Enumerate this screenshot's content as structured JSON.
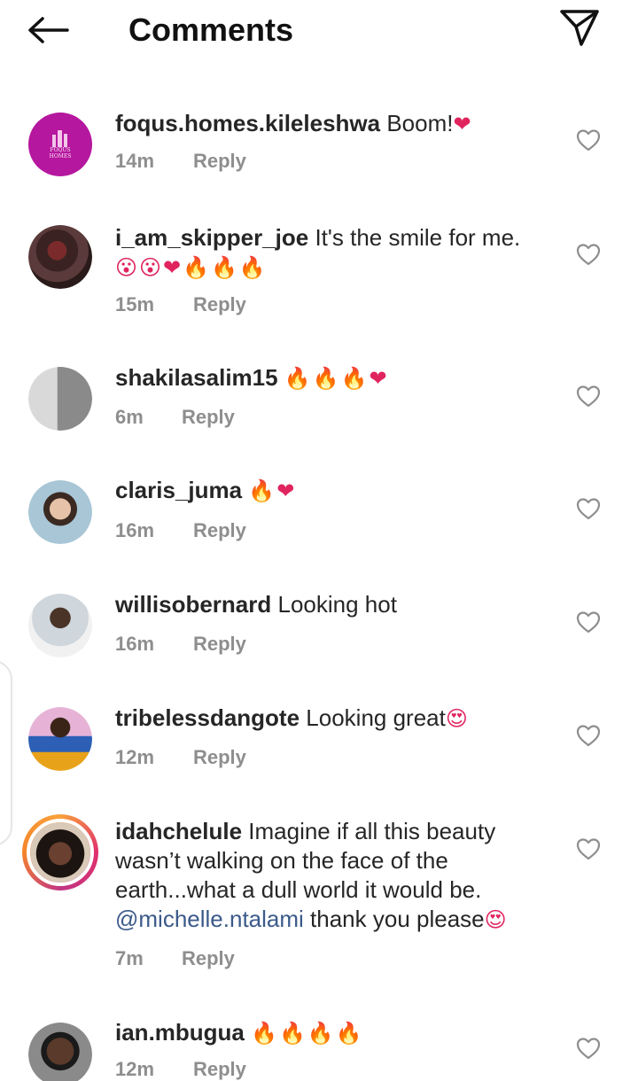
{
  "header": {
    "title": "Comments"
  },
  "comments": [
    {
      "username": "foqus.homes.kileleshwa",
      "text": " Boom!",
      "emojis": "❤",
      "time": "14m",
      "reply": "Reply"
    },
    {
      "username": "i_am_skipper_joe",
      "text": " It's the smile for me.",
      "emojis": "😮😮❤🔥🔥🔥",
      "time": "15m",
      "reply": "Reply"
    },
    {
      "username": "shakilasalim15",
      "text": " ",
      "emojis": "🔥🔥🔥❤",
      "time": "6m",
      "reply": "Reply"
    },
    {
      "username": "claris_juma",
      "text": " ",
      "emojis": "🔥❤",
      "time": "16m",
      "reply": "Reply"
    },
    {
      "username": "willisobernard",
      "text": " Looking hot",
      "emojis": "",
      "time": "16m",
      "reply": "Reply"
    },
    {
      "username": "tribelessdangote",
      "text": " Looking great",
      "emojis": "😍",
      "time": "12m",
      "reply": "Reply"
    },
    {
      "username": "idahchelule",
      "text": " Imagine if all this beauty wasn’t walking on the face of the earth...what a dull world it would be. ",
      "mention": "@michelle.ntalami",
      "text2": " thank you please",
      "emojis": "😍",
      "time": "7m",
      "reply": "Reply"
    },
    {
      "username": "ian.mbugua",
      "text": " ",
      "emojis": "🔥🔥🔥🔥",
      "time": "12m",
      "reply": "Reply"
    }
  ],
  "avatar_logo_text": "FOQUS HOMES"
}
